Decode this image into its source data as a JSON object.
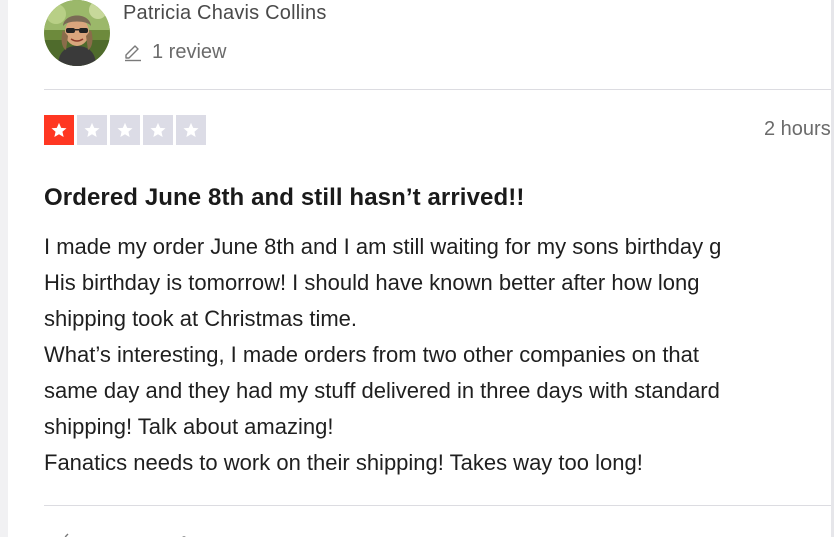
{
  "reviewer": {
    "name": "Patricia Chavis Collins",
    "review_count": "1 review",
    "avatar_icon": "reviewer-avatar-photo",
    "count_icon": "pencil-icon"
  },
  "rating": {
    "stars": 1,
    "max_stars": 5,
    "filled_color": "#ff3722",
    "empty_color": "#dcdce6"
  },
  "timestamp": "2 hours",
  "review": {
    "title": "Ordered June 8th and still hasn’t arrived!!",
    "lines": [
      "I made my order June 8th and I am still waiting for my sons birthday g",
      "His birthday is tomorrow! I should have known better after how long",
      "shipping took at Christmas time.",
      "What’s interesting, I made orders from two other companies on that",
      "same day and they had my stuff delivered in three days with standard",
      "shipping! Talk about amazing!",
      "Fanatics needs to work on their shipping! Takes way too long!"
    ]
  }
}
